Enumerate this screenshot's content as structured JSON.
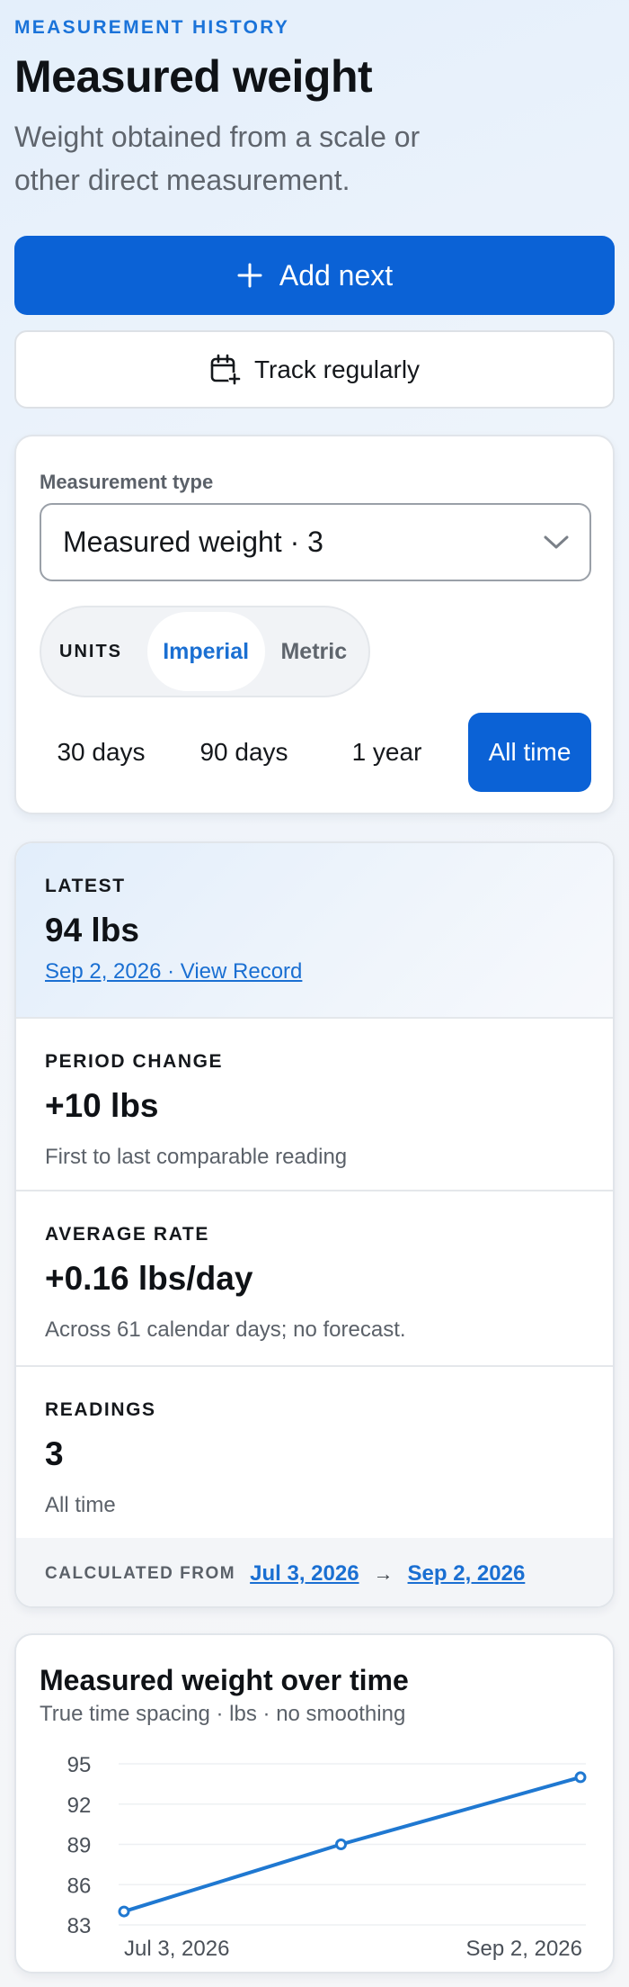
{
  "header": {
    "eyebrow": "MEASUREMENT HISTORY",
    "title": "Measured weight",
    "subtitle": "Weight obtained from a scale or other direct measurement."
  },
  "actions": {
    "add_next_label": "Add next",
    "track_regularly_label": "Track regularly"
  },
  "controls": {
    "measurement_type_label": "Measurement type",
    "measurement_type_value": "Measured weight · 3",
    "units_label": "UNITS",
    "units_options": [
      "Imperial",
      "Metric"
    ],
    "units_selected": "Imperial",
    "ranges": [
      "30 days",
      "90 days",
      "1 year",
      "All time"
    ],
    "range_selected": "All time"
  },
  "stats": {
    "latest": {
      "label": "LATEST",
      "value": "94 lbs",
      "link": "Sep 2, 2026 · View Record"
    },
    "period_change": {
      "label": "PERIOD CHANGE",
      "value": "+10 lbs",
      "sub": "First to last comparable reading"
    },
    "average_rate": {
      "label": "AVERAGE RATE",
      "value": "+0.16 lbs/day",
      "sub": "Across 61 calendar days; no forecast."
    },
    "readings": {
      "label": "READINGS",
      "value": "3",
      "sub": "All time"
    },
    "calculated_from": {
      "label": "CALCULATED FROM",
      "start": "Jul 3, 2026",
      "arrow": "→",
      "end": "Sep 2, 2026"
    }
  },
  "chart": {
    "title": "Measured weight over time",
    "subtitle": "True time spacing · lbs · no smoothing"
  },
  "colors": {
    "accent": "#0b62d6",
    "link": "#1a6fd2",
    "line": "#1f78d1"
  },
  "chart_data": {
    "type": "line",
    "title": "Measured weight over time",
    "subtitle": "True time spacing · lbs · no smoothing",
    "x": [
      "2026-07-03",
      "2026-08-01",
      "2026-09-02"
    ],
    "x_tick_labels": [
      "Jul 3, 2026",
      "Sep 2, 2026"
    ],
    "series": [
      {
        "values": [
          84,
          89,
          94
        ]
      }
    ],
    "y_ticks": [
      95,
      92,
      89,
      86,
      83
    ],
    "ylim": [
      83,
      95
    ],
    "grid": true
  }
}
